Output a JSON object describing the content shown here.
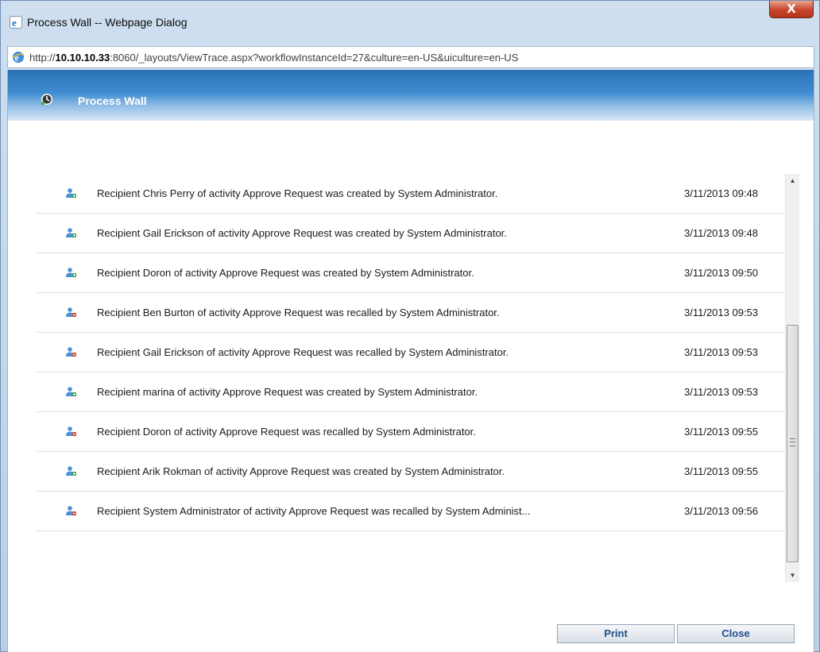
{
  "window": {
    "title": "Process Wall -- Webpage Dialog",
    "close_glyph": "X"
  },
  "address": {
    "url_prefix": "http://",
    "url_host": "10.10.10.33",
    "url_rest": ":8060/_layouts/ViewTrace.aspx?workflowInstanceId=27&culture=en-US&uiculture=en-US"
  },
  "header": {
    "title": "Process Wall",
    "icon": "process-wall-icon"
  },
  "trace": {
    "rows": [
      {
        "icon": "user-add-icon",
        "message": "Recipient Chris Perry of activity Approve Request was created by System Administrator.",
        "time": "3/11/2013 09:48"
      },
      {
        "icon": "user-add-icon",
        "message": "Recipient Gail Erickson of activity Approve Request was created by System Administrator.",
        "time": "3/11/2013 09:48"
      },
      {
        "icon": "user-add-icon",
        "message": "Recipient Doron of activity Approve Request was created by System Administrator.",
        "time": "3/11/2013 09:50"
      },
      {
        "icon": "user-remove-icon",
        "message": "Recipient Ben Burton of activity Approve Request was recalled by System Administrator.",
        "time": "3/11/2013 09:53"
      },
      {
        "icon": "user-remove-icon",
        "message": "Recipient Gail Erickson of activity Approve Request was recalled by System Administrator.",
        "time": "3/11/2013 09:53"
      },
      {
        "icon": "user-add-icon",
        "message": "Recipient marina of activity Approve Request was created by System Administrator.",
        "time": "3/11/2013 09:53"
      },
      {
        "icon": "user-remove-icon",
        "message": "Recipient Doron of activity Approve Request was recalled by System Administrator.",
        "time": "3/11/2013 09:55"
      },
      {
        "icon": "user-add-icon",
        "message": "Recipient Arik Rokman of activity Approve Request was created by System Administrator.",
        "time": "3/11/2013 09:55"
      },
      {
        "icon": "user-remove-icon",
        "message": "Recipient System Administrator of activity Approve Request was recalled by System Administ...",
        "time": "3/11/2013 09:56"
      }
    ]
  },
  "buttons": {
    "print": "Print",
    "close": "Close"
  },
  "colors": {
    "banner": "#2a72b5",
    "button_text": "#1f4f8a"
  }
}
